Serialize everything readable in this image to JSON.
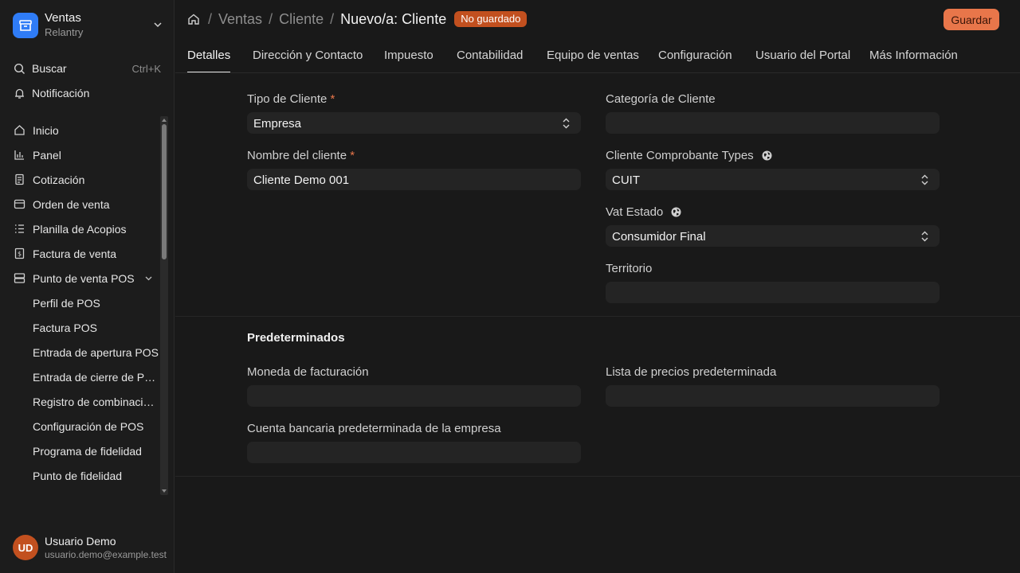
{
  "app": {
    "name": "Ventas",
    "subtitle": "Relantry"
  },
  "utilities": {
    "search_label": "Buscar",
    "search_shortcut": "Ctrl+K",
    "notifications_label": "Notificación"
  },
  "sidebar": {
    "items": [
      {
        "label": "Inicio",
        "icon": "home-icon"
      },
      {
        "label": "Panel",
        "icon": "bar-chart-icon"
      },
      {
        "label": "Cotización",
        "icon": "document-icon"
      },
      {
        "label": "Orden de venta",
        "icon": "window-icon"
      },
      {
        "label": "Planilla de Acopios",
        "icon": "list-icon"
      },
      {
        "label": "Factura de venta",
        "icon": "invoice-icon"
      },
      {
        "label": "Punto de venta POS",
        "icon": "server-icon"
      }
    ],
    "pos_subitems": [
      "Perfil de POS",
      "Factura POS",
      "Entrada de apertura POS",
      "Entrada de cierre de POS",
      "Registro de combinación de factura POS",
      "Configuración de POS",
      "Programa de fidelidad",
      "Punto de fidelidad"
    ]
  },
  "user": {
    "initials": "UD",
    "name": "Usuario Demo",
    "email": "usuario.demo@example.test"
  },
  "header": {
    "breadcrumb": [
      "Ventas",
      "Cliente"
    ],
    "current": "Nuevo/a: Cliente",
    "status_badge": "No guardado",
    "save_label": "Guardar"
  },
  "tabs": [
    "Detalles",
    "Dirección y Contacto",
    "Impuesto",
    "Contabilidad",
    "Equipo de ventas",
    "Configuración",
    "Usuario del Portal",
    "Más Información"
  ],
  "form": {
    "customer_type": {
      "label": "Tipo de Cliente",
      "required": "*",
      "value": "Empresa"
    },
    "customer_name": {
      "label": "Nombre del cliente",
      "required": "*",
      "value": "Cliente Demo 001"
    },
    "customer_category": {
      "label": "Categoría de Cliente",
      "value": ""
    },
    "voucher_types": {
      "label": "Cliente Comprobante Types",
      "value": "CUIT"
    },
    "vat_status": {
      "label": "Vat Estado",
      "value": "Consumidor Final"
    },
    "territory": {
      "label": "Territorio",
      "value": ""
    }
  },
  "defaults": {
    "title": "Predeterminados",
    "billing_currency": {
      "label": "Moneda de facturación",
      "value": ""
    },
    "default_price_list": {
      "label": "Lista de precios predeterminada",
      "value": ""
    },
    "default_bank_account": {
      "label": "Cuenta bancaria predeterminada de la empresa",
      "value": ""
    }
  },
  "colors": {
    "accent": "#e8764a",
    "badge": "#c2501f",
    "app_logo": "#2f7cf6",
    "background": "#191919"
  }
}
